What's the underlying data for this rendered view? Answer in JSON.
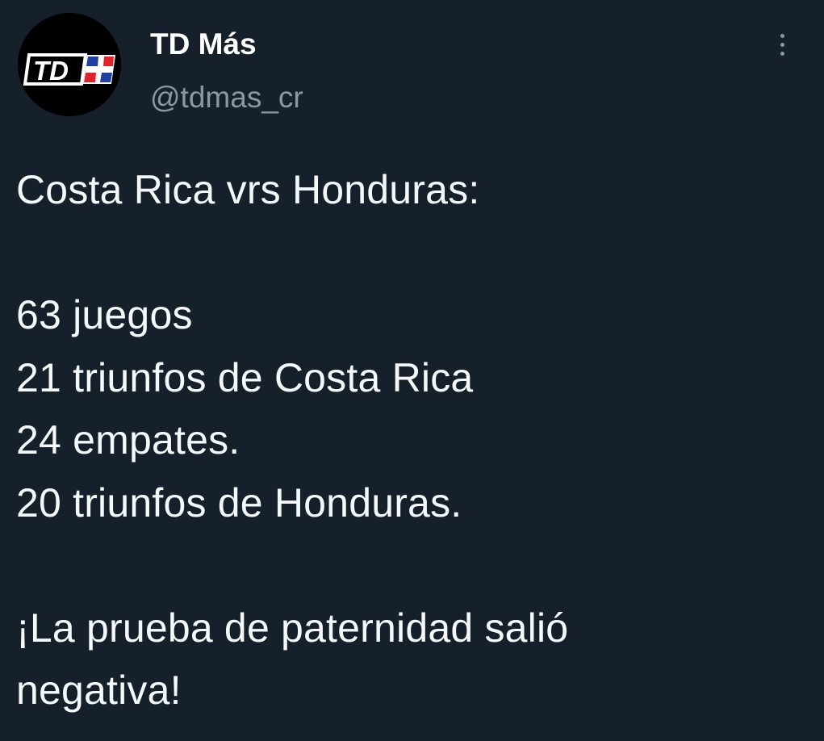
{
  "author": {
    "display_name": "TD Más",
    "handle": "@tdmas_cr",
    "avatar_logo_text": "TD+"
  },
  "menu": {
    "icon": "more-vertical-icon"
  },
  "tweet": {
    "lines": [
      "Costa Rica vrs Honduras:",
      "",
      "63 juegos",
      "21 triunfos de Costa Rica",
      "24 empates.",
      "20 triunfos de Honduras.",
      "",
      "¡La prueba de paternidad salió",
      "negativa!"
    ]
  },
  "colors": {
    "background": "#15202b",
    "text": "#f5f8fa",
    "secondary_text": "#8899a6",
    "logo_blue": "#1f3fa3",
    "logo_red": "#e0232a"
  }
}
